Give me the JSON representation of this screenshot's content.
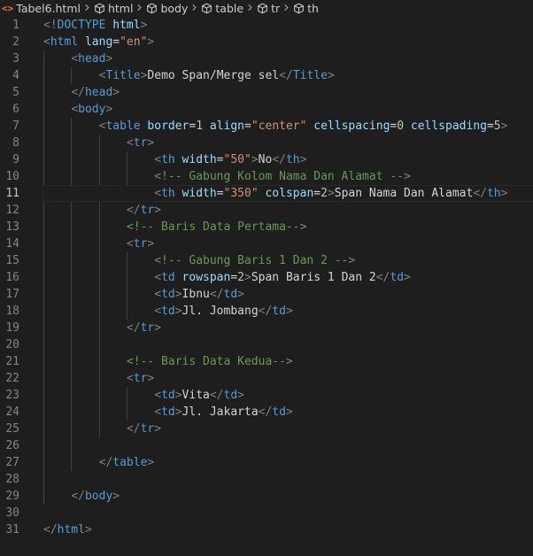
{
  "breadcrumb": {
    "file_icon": "<>",
    "items": [
      "Tabel6.html",
      "html",
      "body",
      "table",
      "tr",
      "th"
    ]
  },
  "editor": {
    "active_line": 11,
    "lines": [
      {
        "n": "1",
        "tokens": [
          {
            "c": "br",
            "t": "<!"
          },
          {
            "c": "doc",
            "t": "DOCTYPE"
          },
          {
            "c": "txt",
            "t": " "
          },
          {
            "c": "attr",
            "t": "html"
          },
          {
            "c": "br",
            "t": ">"
          }
        ]
      },
      {
        "n": "2",
        "tokens": [
          {
            "c": "br",
            "t": "<"
          },
          {
            "c": "tag",
            "t": "html"
          },
          {
            "c": "txt",
            "t": " "
          },
          {
            "c": "attr",
            "t": "lang"
          },
          {
            "c": "eq",
            "t": "="
          },
          {
            "c": "str",
            "t": "\"en\""
          },
          {
            "c": "br",
            "t": ">"
          }
        ]
      },
      {
        "n": "3",
        "tokens": [
          {
            "c": "txt",
            "t": "    "
          },
          {
            "c": "br",
            "t": "<"
          },
          {
            "c": "tag",
            "t": "head"
          },
          {
            "c": "br",
            "t": ">"
          }
        ]
      },
      {
        "n": "4",
        "tokens": [
          {
            "c": "txt",
            "t": "        "
          },
          {
            "c": "br",
            "t": "<"
          },
          {
            "c": "tag",
            "t": "Title"
          },
          {
            "c": "br",
            "t": ">"
          },
          {
            "c": "txt",
            "t": "Demo Span/Merge sel"
          },
          {
            "c": "br",
            "t": "</"
          },
          {
            "c": "tag",
            "t": "Title"
          },
          {
            "c": "br",
            "t": ">"
          }
        ]
      },
      {
        "n": "5",
        "tokens": [
          {
            "c": "txt",
            "t": "    "
          },
          {
            "c": "br",
            "t": "</"
          },
          {
            "c": "tag",
            "t": "head"
          },
          {
            "c": "br",
            "t": ">"
          }
        ]
      },
      {
        "n": "6",
        "tokens": [
          {
            "c": "txt",
            "t": "    "
          },
          {
            "c": "br",
            "t": "<"
          },
          {
            "c": "tag",
            "t": "body"
          },
          {
            "c": "br",
            "t": ">"
          }
        ]
      },
      {
        "n": "7",
        "tokens": [
          {
            "c": "txt",
            "t": "        "
          },
          {
            "c": "br",
            "t": "<"
          },
          {
            "c": "tag",
            "t": "table"
          },
          {
            "c": "txt",
            "t": " "
          },
          {
            "c": "attr",
            "t": "border"
          },
          {
            "c": "eq",
            "t": "="
          },
          {
            "c": "num",
            "t": "1"
          },
          {
            "c": "txt",
            "t": " "
          },
          {
            "c": "attr",
            "t": "align"
          },
          {
            "c": "eq",
            "t": "="
          },
          {
            "c": "str",
            "t": "\"center\""
          },
          {
            "c": "txt",
            "t": " "
          },
          {
            "c": "attr",
            "t": "cellspacing"
          },
          {
            "c": "eq",
            "t": "="
          },
          {
            "c": "num",
            "t": "0"
          },
          {
            "c": "txt",
            "t": " "
          },
          {
            "c": "attr",
            "t": "cellspading"
          },
          {
            "c": "eq",
            "t": "="
          },
          {
            "c": "num",
            "t": "5"
          },
          {
            "c": "br",
            "t": ">"
          }
        ]
      },
      {
        "n": "8",
        "tokens": [
          {
            "c": "txt",
            "t": "            "
          },
          {
            "c": "br",
            "t": "<"
          },
          {
            "c": "tag",
            "t": "tr"
          },
          {
            "c": "br",
            "t": ">"
          }
        ]
      },
      {
        "n": "9",
        "tokens": [
          {
            "c": "txt",
            "t": "                "
          },
          {
            "c": "br",
            "t": "<"
          },
          {
            "c": "tag",
            "t": "th"
          },
          {
            "c": "txt",
            "t": " "
          },
          {
            "c": "attr",
            "t": "width"
          },
          {
            "c": "eq",
            "t": "="
          },
          {
            "c": "str",
            "t": "\"50\""
          },
          {
            "c": "br",
            "t": ">"
          },
          {
            "c": "txt",
            "t": "No"
          },
          {
            "c": "br",
            "t": "</"
          },
          {
            "c": "tag",
            "t": "th"
          },
          {
            "c": "br",
            "t": ">"
          }
        ]
      },
      {
        "n": "10",
        "tokens": [
          {
            "c": "txt",
            "t": "                "
          },
          {
            "c": "com",
            "t": "<!-- Gabung Kolom Nama Dan Alamat -->"
          }
        ]
      },
      {
        "n": "11",
        "tokens": [
          {
            "c": "txt",
            "t": "                "
          },
          {
            "c": "br",
            "t": "<"
          },
          {
            "c": "tag",
            "t": "th"
          },
          {
            "c": "txt",
            "t": " "
          },
          {
            "c": "attr",
            "t": "width"
          },
          {
            "c": "eq",
            "t": "="
          },
          {
            "c": "str",
            "t": "\"350\""
          },
          {
            "c": "txt",
            "t": " "
          },
          {
            "c": "attr",
            "t": "colspan"
          },
          {
            "c": "eq",
            "t": "="
          },
          {
            "c": "num",
            "t": "2"
          },
          {
            "c": "br",
            "t": ">"
          },
          {
            "c": "txt",
            "t": "Span Nama Dan Alamat"
          },
          {
            "c": "br",
            "t": "</"
          },
          {
            "c": "tag",
            "t": "th"
          },
          {
            "c": "br",
            "t": ">"
          }
        ]
      },
      {
        "n": "12",
        "tokens": [
          {
            "c": "txt",
            "t": "            "
          },
          {
            "c": "br",
            "t": "</"
          },
          {
            "c": "tag",
            "t": "tr"
          },
          {
            "c": "br",
            "t": ">"
          }
        ]
      },
      {
        "n": "13",
        "tokens": [
          {
            "c": "txt",
            "t": "            "
          },
          {
            "c": "com",
            "t": "<!-- Baris Data Pertama-->"
          }
        ]
      },
      {
        "n": "14",
        "tokens": [
          {
            "c": "txt",
            "t": "            "
          },
          {
            "c": "br",
            "t": "<"
          },
          {
            "c": "tag",
            "t": "tr"
          },
          {
            "c": "br",
            "t": ">"
          }
        ]
      },
      {
        "n": "15",
        "tokens": [
          {
            "c": "txt",
            "t": "                "
          },
          {
            "c": "com",
            "t": "<!-- Gabung Baris 1 Dan 2 -->"
          }
        ]
      },
      {
        "n": "16",
        "tokens": [
          {
            "c": "txt",
            "t": "                "
          },
          {
            "c": "br",
            "t": "<"
          },
          {
            "c": "tag",
            "t": "td"
          },
          {
            "c": "txt",
            "t": " "
          },
          {
            "c": "attr",
            "t": "rowspan"
          },
          {
            "c": "eq",
            "t": "="
          },
          {
            "c": "num",
            "t": "2"
          },
          {
            "c": "br",
            "t": ">"
          },
          {
            "c": "txt",
            "t": "Span Baris 1 Dan 2"
          },
          {
            "c": "br",
            "t": "</"
          },
          {
            "c": "tag",
            "t": "td"
          },
          {
            "c": "br",
            "t": ">"
          }
        ]
      },
      {
        "n": "17",
        "tokens": [
          {
            "c": "txt",
            "t": "                "
          },
          {
            "c": "br",
            "t": "<"
          },
          {
            "c": "tag",
            "t": "td"
          },
          {
            "c": "br",
            "t": ">"
          },
          {
            "c": "txt",
            "t": "Ibnu"
          },
          {
            "c": "br",
            "t": "</"
          },
          {
            "c": "tag",
            "t": "td"
          },
          {
            "c": "br",
            "t": ">"
          }
        ]
      },
      {
        "n": "18",
        "tokens": [
          {
            "c": "txt",
            "t": "                "
          },
          {
            "c": "br",
            "t": "<"
          },
          {
            "c": "tag",
            "t": "td"
          },
          {
            "c": "br",
            "t": ">"
          },
          {
            "c": "txt",
            "t": "Jl. Jombang"
          },
          {
            "c": "br",
            "t": "</"
          },
          {
            "c": "tag",
            "t": "td"
          },
          {
            "c": "br",
            "t": ">"
          }
        ]
      },
      {
        "n": "19",
        "tokens": [
          {
            "c": "txt",
            "t": "            "
          },
          {
            "c": "br",
            "t": "</"
          },
          {
            "c": "tag",
            "t": "tr"
          },
          {
            "c": "br",
            "t": ">"
          }
        ]
      },
      {
        "n": "20",
        "tokens": []
      },
      {
        "n": "21",
        "tokens": [
          {
            "c": "txt",
            "t": "            "
          },
          {
            "c": "com",
            "t": "<!-- Baris Data Kedua-->"
          }
        ]
      },
      {
        "n": "22",
        "tokens": [
          {
            "c": "txt",
            "t": "            "
          },
          {
            "c": "br",
            "t": "<"
          },
          {
            "c": "tag",
            "t": "tr"
          },
          {
            "c": "br",
            "t": ">"
          }
        ]
      },
      {
        "n": "23",
        "tokens": [
          {
            "c": "txt",
            "t": "                "
          },
          {
            "c": "br",
            "t": "<"
          },
          {
            "c": "tag",
            "t": "td"
          },
          {
            "c": "br",
            "t": ">"
          },
          {
            "c": "txt",
            "t": "Vita"
          },
          {
            "c": "br",
            "t": "</"
          },
          {
            "c": "tag",
            "t": "td"
          },
          {
            "c": "br",
            "t": ">"
          }
        ]
      },
      {
        "n": "24",
        "tokens": [
          {
            "c": "txt",
            "t": "                "
          },
          {
            "c": "br",
            "t": "<"
          },
          {
            "c": "tag",
            "t": "td"
          },
          {
            "c": "br",
            "t": ">"
          },
          {
            "c": "txt",
            "t": "Jl. Jakarta"
          },
          {
            "c": "br",
            "t": "</"
          },
          {
            "c": "tag",
            "t": "td"
          },
          {
            "c": "br",
            "t": ">"
          }
        ]
      },
      {
        "n": "25",
        "tokens": [
          {
            "c": "txt",
            "t": "            "
          },
          {
            "c": "br",
            "t": "</"
          },
          {
            "c": "tag",
            "t": "tr"
          },
          {
            "c": "br",
            "t": ">"
          }
        ]
      },
      {
        "n": "26",
        "tokens": []
      },
      {
        "n": "27",
        "tokens": [
          {
            "c": "txt",
            "t": "        "
          },
          {
            "c": "br",
            "t": "</"
          },
          {
            "c": "tag",
            "t": "table"
          },
          {
            "c": "br",
            "t": ">"
          }
        ]
      },
      {
        "n": "28",
        "tokens": []
      },
      {
        "n": "29",
        "tokens": [
          {
            "c": "txt",
            "t": "    "
          },
          {
            "c": "br",
            "t": "</"
          },
          {
            "c": "tag",
            "t": "body"
          },
          {
            "c": "br",
            "t": ">"
          }
        ]
      },
      {
        "n": "30",
        "tokens": []
      },
      {
        "n": "31",
        "tokens": [
          {
            "c": "br",
            "t": "</"
          },
          {
            "c": "tag",
            "t": "html"
          },
          {
            "c": "br",
            "t": ">"
          }
        ]
      }
    ]
  },
  "colors": {
    "background": "#1e1e1e",
    "tag": "#569cd6",
    "attribute": "#9cdcfe",
    "string": "#ce9178",
    "number": "#b5cea8",
    "comment": "#6a9955",
    "bracket": "#808080",
    "line_number": "#858585"
  }
}
